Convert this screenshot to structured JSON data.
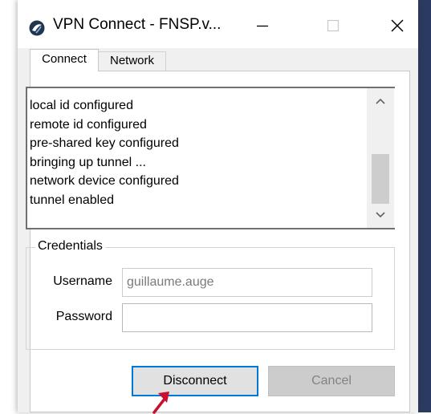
{
  "window": {
    "title": "VPN Connect - FNSP.v...",
    "controls": {
      "minimize": "minimize-icon",
      "maximize": "maximize-icon",
      "close": "close-icon"
    }
  },
  "tabs": [
    {
      "label": "Connect",
      "selected": true
    },
    {
      "label": "Network",
      "selected": false
    }
  ],
  "log": {
    "lines": [
      "local id configured",
      "remote id configured",
      "pre-shared key configured",
      "bringing up tunnel ...",
      "network device configured",
      "tunnel enabled"
    ]
  },
  "credentials": {
    "legend": "Credentials",
    "username_label": "Username",
    "username_value": "guillaume.auge",
    "password_label": "Password",
    "password_value": ""
  },
  "buttons": {
    "disconnect": "Disconnect",
    "cancel": "Cancel"
  },
  "colors": {
    "focus_border": "#0078d7",
    "cursor_arrow": "#c8102e"
  }
}
